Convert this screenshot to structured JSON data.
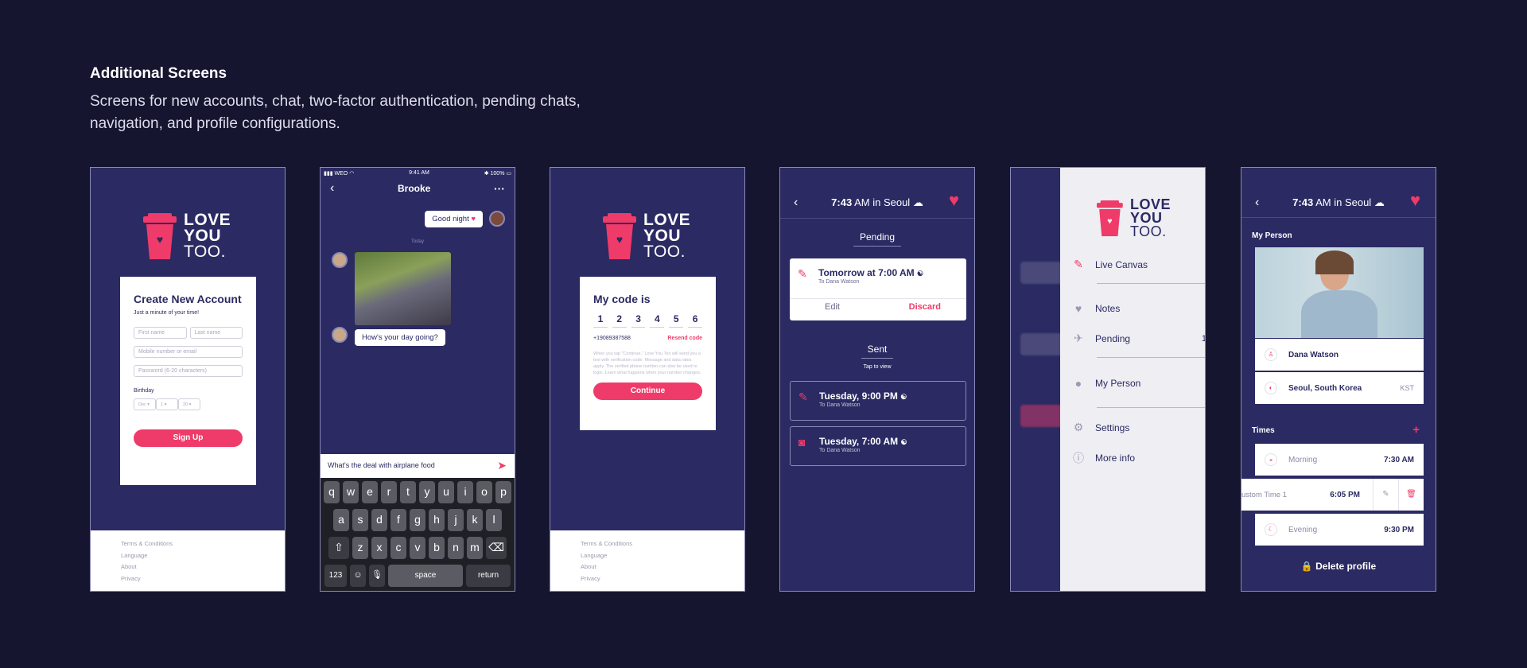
{
  "heading": "Additional Screens",
  "subheading": "Screens for new accounts, chat, two-factor authentication, pending chats, navigation, and profile configurations.",
  "brand": {
    "line1": "LOVE",
    "line2": "YOU",
    "line3": "TOO.",
    "accent": "#ef3b69",
    "navy": "#2b2a63"
  },
  "signup": {
    "title": "Create New Account",
    "subtitle": "Just a minute of your time!",
    "first_name_placeholder": "First name",
    "last_name_placeholder": "Last name",
    "contact_placeholder": "Mobile number or email",
    "password_placeholder": "Password (6-20 characters)",
    "birthday_label": "Birthday",
    "month": "Dec",
    "day": "1",
    "year": "20",
    "submit": "Sign Up"
  },
  "footer_links": [
    "Terms & Conditions",
    "Language",
    "About",
    "Privacy"
  ],
  "chat": {
    "carrier": "WEO",
    "time": "9:41 AM",
    "battery": "100%",
    "contact": "Brooke",
    "sent_message": "Good night",
    "day_separator": "Today",
    "received_message": "How's your day going?",
    "draft": "What's the deal with airplane food",
    "keys_row1": [
      "q",
      "w",
      "e",
      "r",
      "t",
      "y",
      "u",
      "i",
      "o",
      "p"
    ],
    "keys_row2": [
      "a",
      "s",
      "d",
      "f",
      "g",
      "h",
      "j",
      "k",
      "l"
    ],
    "keys_row3": [
      "z",
      "x",
      "c",
      "v",
      "b",
      "n",
      "m"
    ],
    "key_numbers": "123",
    "key_space": "space",
    "key_return": "return"
  },
  "twofa": {
    "title": "My code is",
    "digits": [
      "1",
      "2",
      "3",
      "4",
      "5",
      "6"
    ],
    "phone": "+19089387588",
    "resend": "Resend code",
    "fine_print": "When you tap \"Continue,\" Love You Too will send you a text with verification code. Message and data rates apply. The verified phone number can also be used to login. Learn what happens when your number changes.",
    "continue": "Continue"
  },
  "pending": {
    "time": "7:43",
    "time_suffix": "AM in Seoul",
    "pending_label": "Pending",
    "pending_card": {
      "title": "Tomorrow at 7:00 AM",
      "recipient": "To Dana Watson",
      "edit": "Edit",
      "discard": "Discard"
    },
    "sent_label": "Sent",
    "tap_hint": "Tap to view",
    "sent_cards": [
      {
        "title": "Tuesday, 9:00 PM",
        "recipient": "To Dana Watson"
      },
      {
        "title": "Tuesday, 7:00 AM",
        "recipient": "To Dana Watson"
      }
    ]
  },
  "menu": {
    "items": [
      {
        "label": "Live Canvas",
        "icon": "brush-icon"
      },
      {
        "label": "Notes",
        "icon": "heart-icon"
      },
      {
        "label": "Pending",
        "icon": "paper-plane-icon",
        "count": "1"
      },
      {
        "label": "My Person",
        "icon": "person-icon"
      },
      {
        "label": "Settings",
        "icon": "gear-icon"
      },
      {
        "label": "More info",
        "icon": "info-icon"
      }
    ]
  },
  "profile": {
    "time": "7:43",
    "time_suffix": "AM in Seoul",
    "my_person_label": "My Person",
    "name": "Dana Watson",
    "location": "Seoul, South Korea",
    "timezone": "KST",
    "times_label": "Times",
    "times": [
      {
        "label": "Morning",
        "value": "7:30 AM"
      },
      {
        "label": "ustom Time 1",
        "value": "6:05 PM"
      },
      {
        "label": "Evening",
        "value": "9:30 PM"
      }
    ],
    "delete": "Delete profile"
  }
}
